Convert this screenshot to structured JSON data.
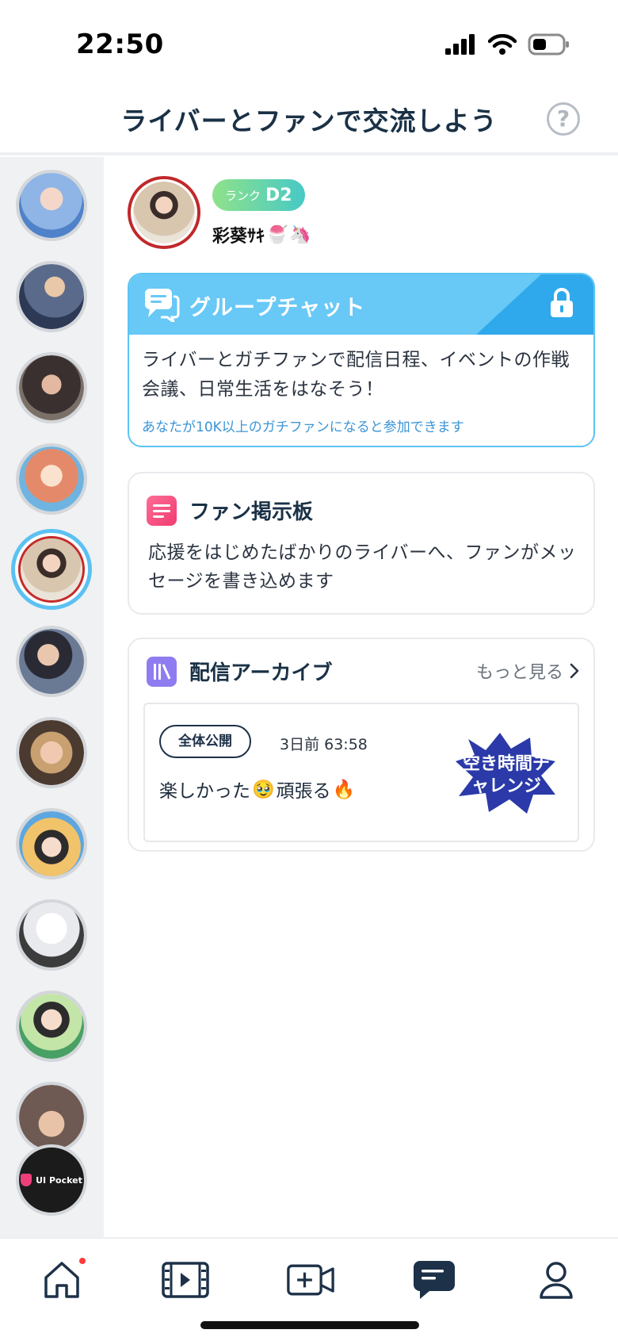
{
  "status_bar": {
    "time": "22:50"
  },
  "header": {
    "title": "ライバーとファンで交流しよう",
    "help_label": "?"
  },
  "sidebar": {
    "avatars": [
      {
        "name": "liver-1",
        "color": "#8fb5e6"
      },
      {
        "name": "liver-2",
        "color": "#5a6a8a"
      },
      {
        "name": "liver-3",
        "color": "#3a3030"
      },
      {
        "name": "liver-4",
        "color": "#e48a6a"
      },
      {
        "name": "liver-5",
        "color": "#d9c6ae",
        "selected": true
      },
      {
        "name": "liver-6",
        "color": "#6a7a95"
      },
      {
        "name": "liver-7",
        "color": "#9a6e50"
      },
      {
        "name": "liver-8",
        "color": "#f1c36b"
      },
      {
        "name": "liver-9",
        "color": "#e9eaee"
      },
      {
        "name": "liver-10",
        "color": "#c4e5a8"
      },
      {
        "name": "liver-11",
        "color": "#6e5a52"
      }
    ],
    "pocket_label": "UI Pocket"
  },
  "profile": {
    "rank_label": "ランク",
    "rank_value": "D2",
    "name": "彩葵ｻｷ",
    "name_emojis": [
      "🍧",
      "🦄"
    ]
  },
  "group_chat": {
    "title": "グループチャット",
    "description": "ライバーとガチファンで配信日程、イベントの作戦会議、日常生活をはなそう！",
    "note": "あなたが10K以上のガチファンになると参加できます",
    "locked": true
  },
  "fan_board": {
    "title": "ファン掲示板",
    "description": "応援をはじめたばかりのライバーへ、ファンがメッセージを書き込めます"
  },
  "archive": {
    "title": "配信アーカイブ",
    "more_label": "もっと見る",
    "items": [
      {
        "visibility": "全体公開",
        "meta": "3日前 63:58",
        "title_parts": [
          "楽しかった",
          "🥹",
          "頑張る",
          "🔥"
        ],
        "thumbnail_text": "空き時間チャレンジ"
      }
    ]
  },
  "bottom_nav": {
    "items": [
      "home",
      "video",
      "live",
      "chat",
      "profile"
    ],
    "active": "chat",
    "home_has_notification": true
  },
  "colors": {
    "accent": "#5cc1f2",
    "group_chat_header": "#68c8f6",
    "rank_gradient_start": "#8fe28a",
    "rank_gradient_end": "#47c9c6",
    "board_icon": "#f03c72",
    "archive_icon": "#8f7cf0",
    "dark_text": "#1a3146"
  }
}
